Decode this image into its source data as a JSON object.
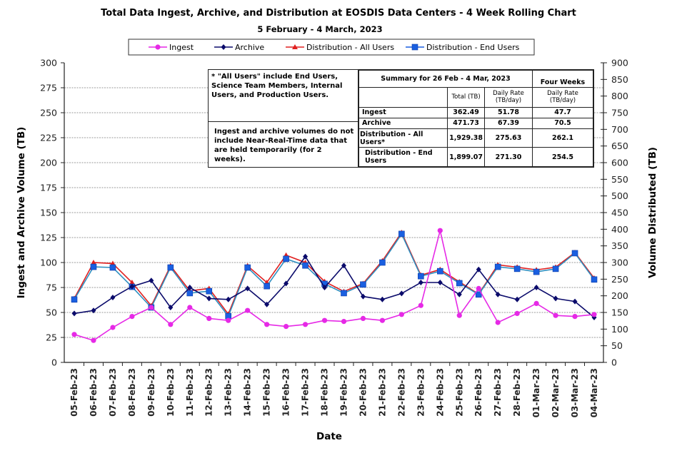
{
  "title": "Total Data Ingest, Archive, and  Distribution at EOSDIS Data Centers - 4 Week Rolling Chart",
  "subtitle": "5  February  -  4  March,  2023",
  "notes": {
    "all_users": "* \"All Users\" include End Users, Science Team Members,  Internal Users, and Production Users.",
    "nrt": "Ingest and archive volumes do not include Near-Real-Time data that are held temporarily (for 2 weeks)."
  },
  "summary_table": {
    "title": "Summary for  26  Feb  -  4  Mar,  2023",
    "four_weeks_label": "Four Weeks",
    "col_total": "Total (TB)",
    "col_daily": "Daily Rate (TB/day)",
    "col_four_daily": "Daily Rate (TB/day)",
    "rows": [
      {
        "label": "Ingest",
        "total": "362.49",
        "daily": "51.78",
        "four_weeks": "47.7"
      },
      {
        "label": "Archive",
        "total": "471.73",
        "daily": "67.39",
        "four_weeks": "70.5"
      },
      {
        "label": "Distribution - All Users*",
        "total": "1,929.38",
        "daily": "275.63",
        "four_weeks": "262.1"
      },
      {
        "label": "Distribution - End Users",
        "total": "1,899.07",
        "daily": "271.30",
        "four_weeks": "254.5"
      }
    ]
  },
  "chart_data": {
    "type": "line",
    "title": "Total Data Ingest, Archive, and  Distribution at EOSDIS Data Centers - 4 Week Rolling Chart",
    "subtitle": "5  February  -  4  March,  2023",
    "xlabel": "Date",
    "ylabel": "Ingest and Archive Volume (TB)",
    "y2label": "Volume Distributed (TB)",
    "ylim": [
      0,
      300
    ],
    "y2lim": [
      0,
      900
    ],
    "yticks": [
      0,
      25,
      50,
      75,
      100,
      125,
      150,
      175,
      200,
      225,
      250,
      275,
      300
    ],
    "y2ticks": [
      0,
      50,
      100,
      150,
      200,
      250,
      300,
      350,
      400,
      450,
      500,
      550,
      600,
      650,
      700,
      750,
      800,
      850,
      900
    ],
    "grid": true,
    "legend_position": "top",
    "categories": [
      "05-Feb-23",
      "06-Feb-23",
      "07-Feb-23",
      "08-Feb-23",
      "09-Feb-23",
      "10-Feb-23",
      "11-Feb-23",
      "12-Feb-23",
      "13-Feb-23",
      "14-Feb-23",
      "15-Feb-23",
      "16-Feb-23",
      "17-Feb-23",
      "18-Feb-23",
      "19-Feb-23",
      "20-Feb-23",
      "21-Feb-23",
      "22-Feb-23",
      "23-Feb-23",
      "24-Feb-23",
      "25-Feb-23",
      "26-Feb-23",
      "27-Feb-23",
      "28-Feb-23",
      "01-Mar-23",
      "02-Mar-23",
      "03-Mar-23",
      "04-Mar-23"
    ],
    "series": [
      {
        "name": "Ingest",
        "axis": "left",
        "color": "#e629e6",
        "marker": "circle",
        "values": [
          28,
          22,
          35,
          46,
          55,
          38,
          55,
          44,
          42,
          52,
          38,
          36,
          38,
          42,
          41,
          44,
          42,
          48,
          57,
          132,
          47,
          74,
          40,
          49,
          59,
          47,
          46,
          48
        ]
      },
      {
        "name": "Archive",
        "axis": "left",
        "color": "#0b0b6b",
        "marker": "diamond",
        "values": [
          49,
          52,
          65,
          76,
          82,
          55,
          75,
          64,
          63,
          74,
          58,
          79,
          106,
          75,
          97,
          66,
          63,
          69,
          80,
          80,
          68,
          93,
          68,
          63,
          75,
          64,
          61,
          45
        ]
      },
      {
        "name": "Distribution - All Users",
        "axis": "right",
        "color": "#e02020",
        "marker": "triangle",
        "values": [
          192,
          300,
          297,
          240,
          170,
          290,
          215,
          222,
          145,
          290,
          240,
          322,
          300,
          243,
          213,
          237,
          305,
          390,
          262,
          279,
          242,
          205,
          293,
          286,
          278,
          286,
          330,
          253
        ]
      },
      {
        "name": "Distribution - End Users",
        "axis": "right",
        "color": "#1a5fe0",
        "marker": "square",
        "values": [
          189,
          287,
          285,
          227,
          165,
          285,
          208,
          214,
          139,
          285,
          229,
          311,
          291,
          236,
          208,
          234,
          300,
          386,
          259,
          274,
          238,
          204,
          287,
          281,
          272,
          281,
          328,
          249
        ]
      }
    ]
  }
}
